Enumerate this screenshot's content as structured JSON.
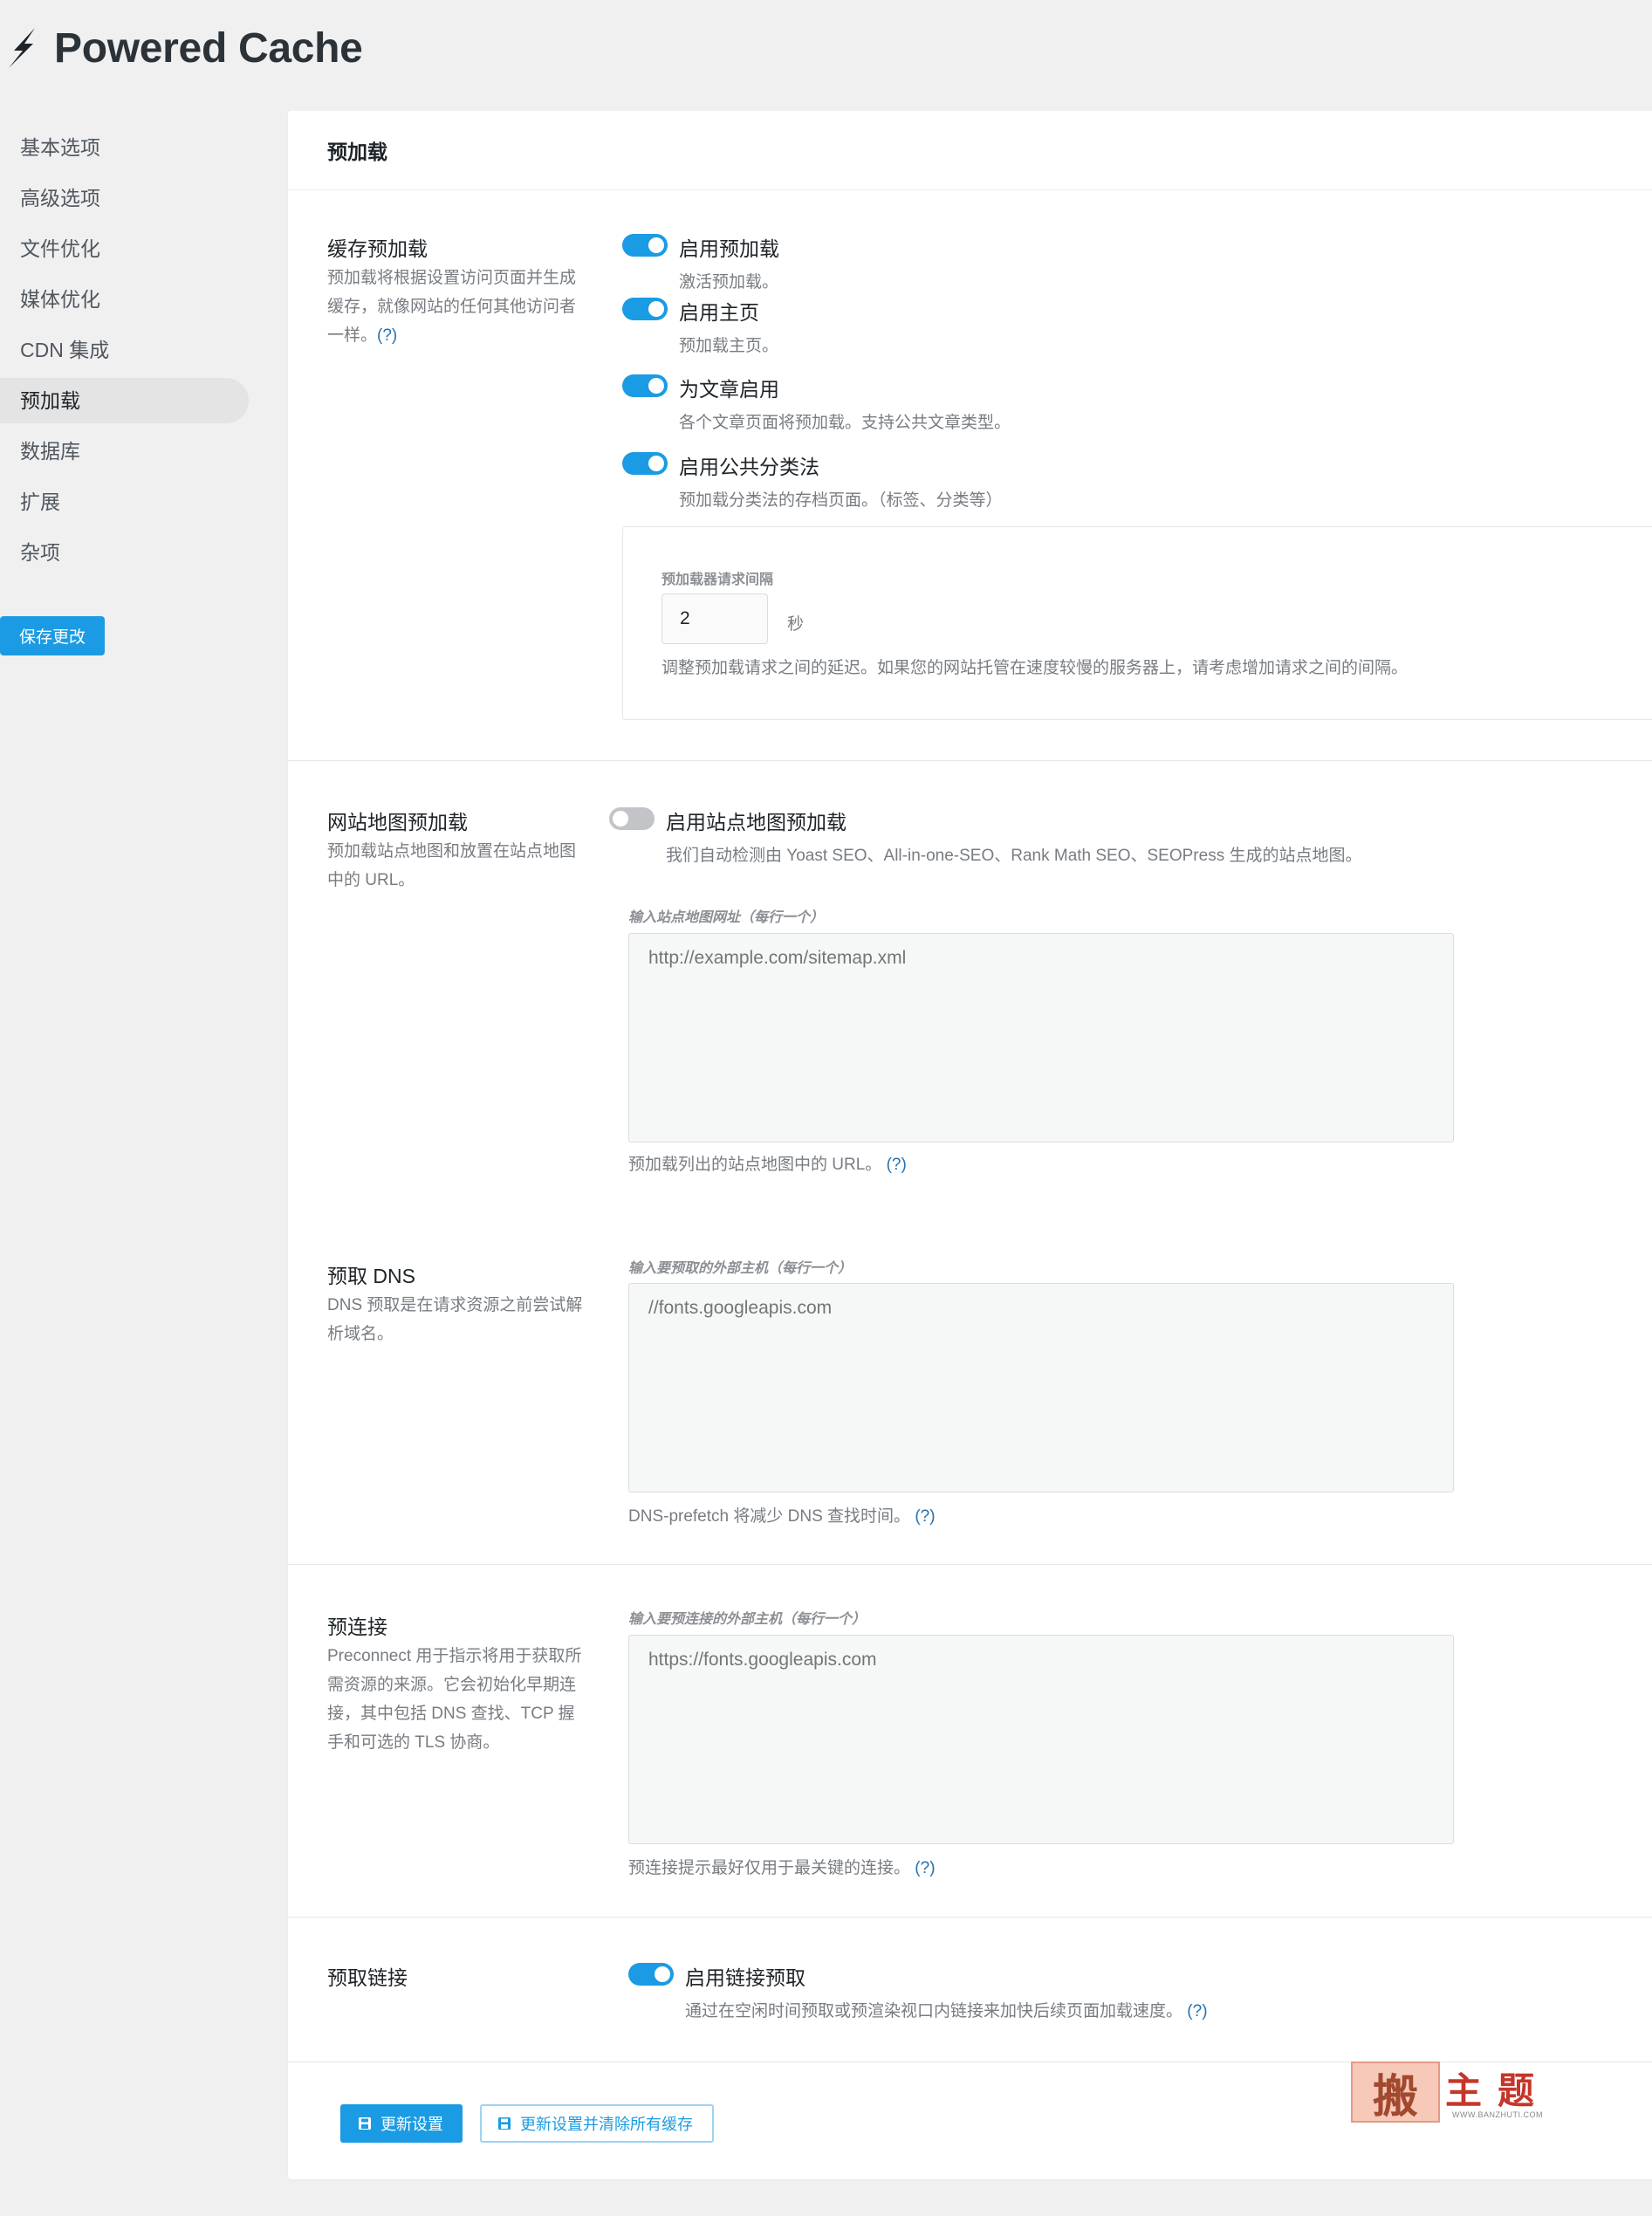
{
  "app": {
    "title": "Powered Cache",
    "logo_icon": "lightning-bolt-icon"
  },
  "sidebar": {
    "items": [
      {
        "label": "基本选项",
        "active": false
      },
      {
        "label": "高级选项",
        "active": false
      },
      {
        "label": "文件优化",
        "active": false
      },
      {
        "label": "媒体优化",
        "active": false
      },
      {
        "label": "CDN 集成",
        "active": false
      },
      {
        "label": "预加载",
        "active": true
      },
      {
        "label": "数据库",
        "active": false
      },
      {
        "label": "扩展",
        "active": false
      },
      {
        "label": "杂项",
        "active": false
      }
    ],
    "save_label": "保存更改"
  },
  "panel": {
    "title": "预加载"
  },
  "cache_preload": {
    "label": "缓存预加载",
    "desc": "预加载将根据设置访问页面并生成缓存，就像网站的任何其他访问者一样。",
    "help": "(?)",
    "toggles": [
      {
        "label": "启用预加载",
        "desc": "激活预加载。",
        "on": true
      },
      {
        "label": "启用主页",
        "desc": "预加载主页。",
        "on": true
      },
      {
        "label": "为文章启用",
        "desc": "各个文章页面将预加载。支持公共文章类型。",
        "on": true
      },
      {
        "label": "启用公共分类法",
        "desc": "预加载分类法的存档页面。（标签、分类等）",
        "on": true
      }
    ],
    "interval": {
      "label": "预加载器请求间隔",
      "value": "2",
      "unit": "秒",
      "desc": "调整预加载请求之间的延迟。如果您的网站托管在速度较慢的服务器上，请考虑增加请求之间的间隔。"
    }
  },
  "sitemap_preload": {
    "label": "网站地图预加载",
    "desc": "预加载站点地图和放置在站点地图中的 URL。",
    "toggle_label": "启用站点地图预加载",
    "toggle_on": false,
    "toggle_desc": "我们自动检测由 Yoast SEO、All-in-one-SEO、Rank Math SEO、SEOPress 生成的站点地图。",
    "field_label": "输入站点地图网址（每行一个）",
    "placeholder": "http://example.com/sitemap.xml",
    "help_text": "预加载列出的站点地图中的 URL。",
    "help": "(?)"
  },
  "dns_prefetch": {
    "label": "预取 DNS",
    "desc": "DNS 预取是在请求资源之前尝试解析域名。",
    "field_label": "输入要预取的外部主机（每行一个）",
    "placeholder": "//fonts.googleapis.com",
    "help_text": "DNS-prefetch 将减少 DNS 查找时间。",
    "help": "(?)"
  },
  "preconnect": {
    "label": "预连接",
    "desc": "Preconnect 用于指示将用于获取所需资源的来源。它会初始化早期连接，其中包括 DNS 查找、TCP 握手和可选的 TLS 协商。",
    "field_label": "输入要预连接的外部主机（每行一个）",
    "placeholder": "https://fonts.googleapis.com",
    "help_text": "预连接提示最好仅用于最关键的连接。",
    "help": "(?)"
  },
  "link_prefetch": {
    "label": "预取链接",
    "toggle_label": "启用链接预取",
    "toggle_on": true,
    "toggle_desc": "通过在空闲时间预取或预渲染视口内链接来加快后续页面加载速度。",
    "help": "(?)"
  },
  "footer": {
    "update_label": "更新设置",
    "update_purge_label": "更新设置并清除所有缓存"
  },
  "watermark": {
    "seal": "搬",
    "text": "主题",
    "url": "WWW.BANZHUTI.COM"
  },
  "colors": {
    "accent": "#1b9be3",
    "toggle_off": "#c3c4c7"
  }
}
